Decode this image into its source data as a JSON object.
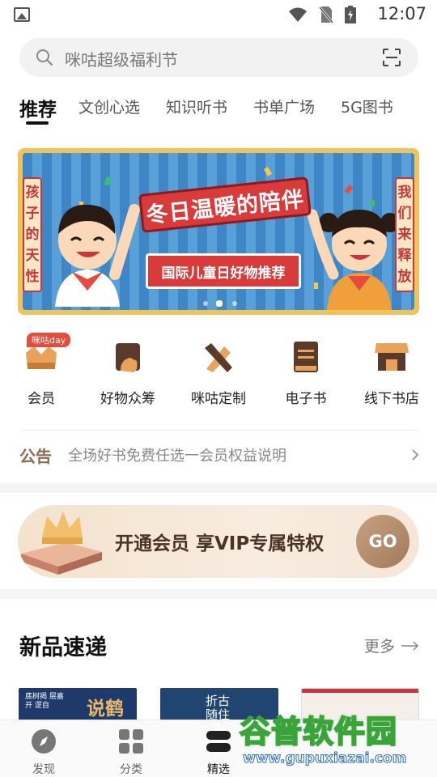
{
  "status_bar": {
    "time": "12:07"
  },
  "search": {
    "placeholder": "咪咕超级福利节"
  },
  "tabs": [
    {
      "label": "推荐",
      "active": true
    },
    {
      "label": "文创心选"
    },
    {
      "label": "知识听书"
    },
    {
      "label": "书单广场"
    },
    {
      "label": "5G图书"
    }
  ],
  "banner": {
    "title": "冬日温暖的陪伴",
    "subtitle": "国际儿童日好物推荐",
    "left_side": [
      "孩",
      "子",
      "的",
      "天",
      "性"
    ],
    "right_side": [
      "我",
      "们",
      "来",
      "释",
      "放"
    ],
    "active_slide": 1,
    "slide_count": 3
  },
  "quick_entries": [
    {
      "label": "会员",
      "badge": "咪咕day",
      "icon": "member-icon"
    },
    {
      "label": "好物众筹",
      "icon": "crowdfunding-icon"
    },
    {
      "label": "咪咕定制",
      "icon": "custom-icon"
    },
    {
      "label": "电子书",
      "icon": "ebook-icon"
    },
    {
      "label": "线下书店",
      "icon": "bookstore-icon"
    }
  ],
  "notice": {
    "tag": "公告",
    "text": "全场好书免费任选一会员权益说明"
  },
  "vip": {
    "title": "开通会员 享VIP专属特权",
    "button": "GO"
  },
  "new_arrivals": {
    "title": "新品速递",
    "more": "更多",
    "books": [
      {
        "cover_text": "说鹤",
        "cover_small": "底树揭 层嘉开 逻自"
      },
      {
        "cover_text": "折古 随住"
      },
      {
        "cover_text": ""
      }
    ]
  },
  "bottom_nav": [
    {
      "label": "发现",
      "icon": "discover-icon"
    },
    {
      "label": "分类",
      "icon": "category-icon"
    },
    {
      "label": "精选",
      "icon": "featured-icon",
      "active": true
    }
  ],
  "watermark": {
    "title": "谷普软件园",
    "url": "www.gupuxiazai.com"
  },
  "colors": {
    "accent": "#c8363b",
    "vip_brown": "#4a3325",
    "banner_blue": "#3e86c5"
  }
}
